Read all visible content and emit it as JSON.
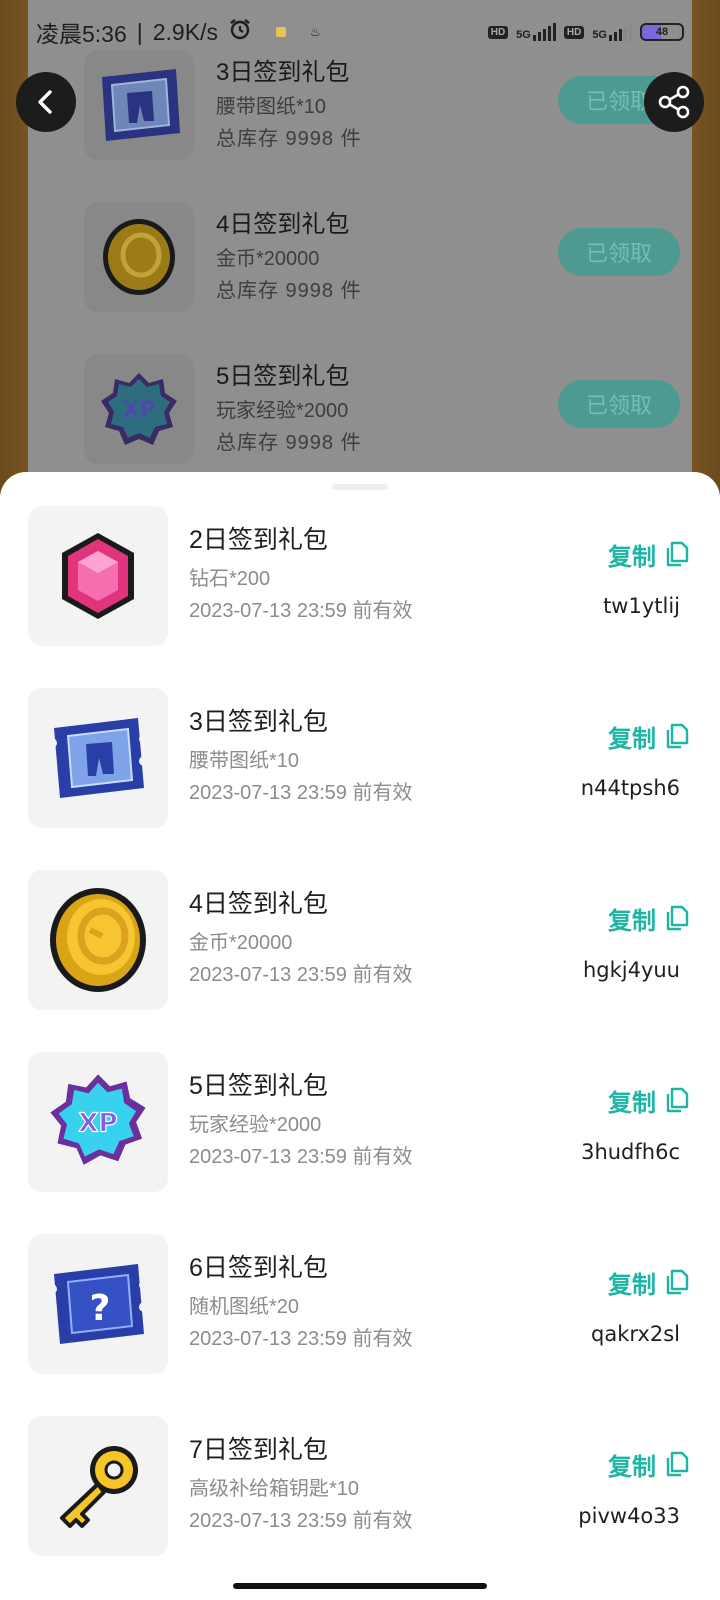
{
  "status_bar": {
    "time": "凌晨5:36",
    "speed": "2.9K/s",
    "hd_badge": "HD",
    "network_label": "5G",
    "battery": "48"
  },
  "background_list": [
    {
      "title": "3日签到礼包",
      "desc": "腰带图纸*10",
      "stock": "总库存 9998 件",
      "button": "已领取",
      "icon": "blueprint-belt"
    },
    {
      "title": "4日签到礼包",
      "desc": "金币*20000",
      "stock": "总库存 9998 件",
      "button": "已领取",
      "icon": "gold-coin"
    },
    {
      "title": "5日签到礼包",
      "desc": "玩家经验*2000",
      "stock": "总库存 9998 件",
      "button": "已领取",
      "icon": "xp-badge"
    }
  ],
  "gifts": [
    {
      "title": "2日签到礼包",
      "desc": "钻石*200",
      "valid": "2023-07-13 23:59 前有效",
      "copy_label": "复制",
      "code": "tw1ytlij",
      "icon": "diamond-gem"
    },
    {
      "title": "3日签到礼包",
      "desc": "腰带图纸*10",
      "valid": "2023-07-13 23:59 前有效",
      "copy_label": "复制",
      "code": "n44tpsh6",
      "icon": "blueprint-belt"
    },
    {
      "title": "4日签到礼包",
      "desc": "金币*20000",
      "valid": "2023-07-13 23:59 前有效",
      "copy_label": "复制",
      "code": "hgkj4yuu",
      "icon": "gold-coin"
    },
    {
      "title": "5日签到礼包",
      "desc": "玩家经验*2000",
      "valid": "2023-07-13 23:59 前有效",
      "copy_label": "复制",
      "code": "3hudfh6c",
      "icon": "xp-badge"
    },
    {
      "title": "6日签到礼包",
      "desc": "随机图纸*20",
      "valid": "2023-07-13 23:59 前有效",
      "copy_label": "复制",
      "code": "qakrx2sl",
      "icon": "random-blueprint"
    },
    {
      "title": "7日签到礼包",
      "desc": "高级补给箱钥匙*10",
      "valid": "2023-07-13 23:59 前有效",
      "copy_label": "复制",
      "code": "pivw4o33",
      "icon": "golden-key"
    }
  ],
  "colors": {
    "accent": "#1fb4a4",
    "muted_text": "#8c8c8c",
    "claimed_button": "#4d9a93",
    "thumb_bg": "#f3f3f3"
  }
}
